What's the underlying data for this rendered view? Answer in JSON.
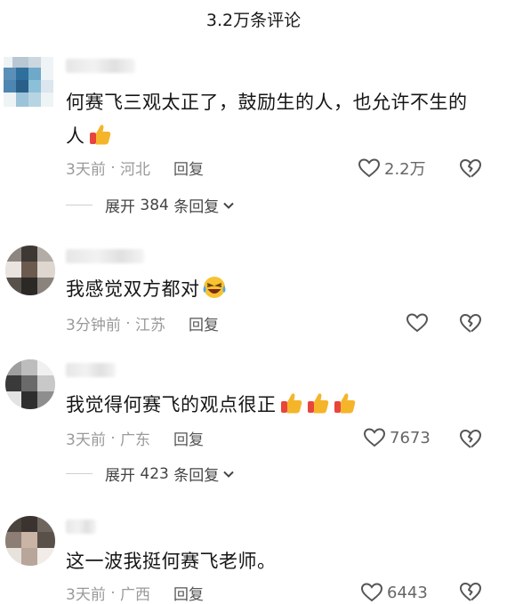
{
  "header": {
    "title": "3.2万条评论"
  },
  "comments": [
    {
      "text": "何赛飞三观太正了，鼓励生的人，也允许不生的人",
      "emoji": "thumbs-up-icon",
      "time": "3天前",
      "location": "河北",
      "reply_label": "回复",
      "likes": "2.2万",
      "expand": {
        "prefix": "展开",
        "count": "384",
        "suffix": "条回复"
      }
    },
    {
      "text": "我感觉双方都对",
      "emoji": "laughing-crying-icon",
      "time": "3分钟前",
      "location": "江苏",
      "reply_label": "回复",
      "likes": ""
    },
    {
      "text": "我觉得何赛飞的观点很正",
      "emoji": "thumbs-up-icon x3",
      "time": "3天前",
      "location": "广东",
      "reply_label": "回复",
      "likes": "7673",
      "expand": {
        "prefix": "展开",
        "count": "423",
        "suffix": "条回复"
      }
    },
    {
      "text": "这一波我挺何赛飞老师。",
      "time": "3天前",
      "location": "广西",
      "reply_label": "回复",
      "likes": "6443"
    }
  ],
  "colors": {
    "meta_text": "#9a9a9a",
    "thumb": "#f5b52a",
    "thumb_cuff": "#e8453c"
  }
}
